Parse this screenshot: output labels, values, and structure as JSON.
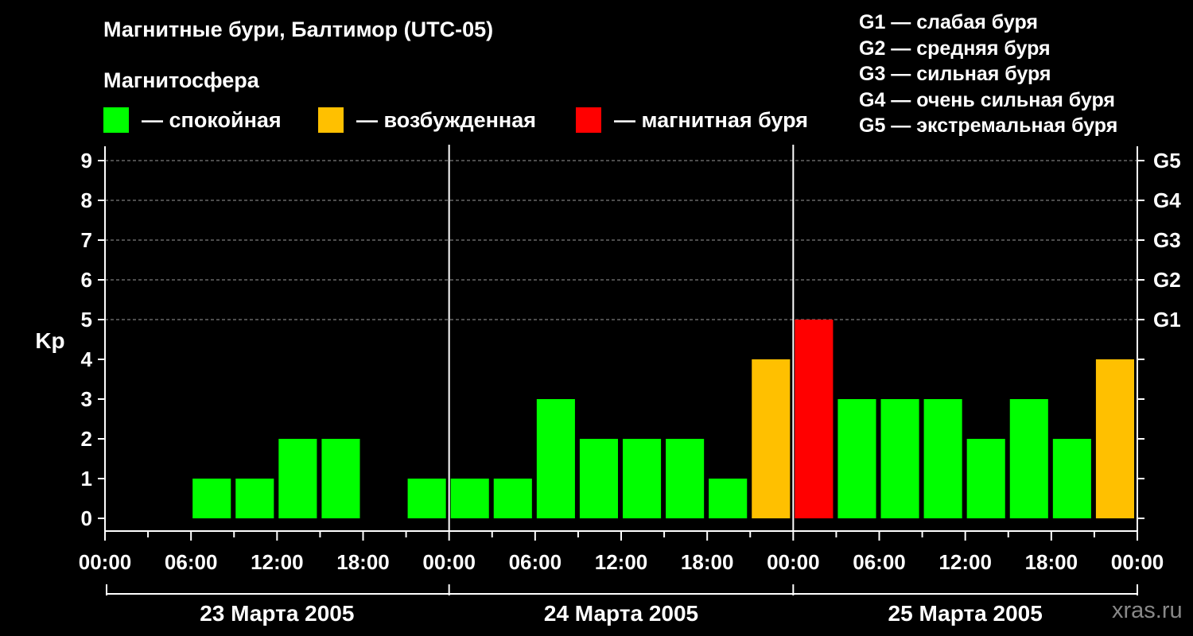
{
  "header": {
    "title": "Магнитные бури, Балтимор (UTC-05)",
    "subtitle": "Магнитосфера"
  },
  "legend": [
    {
      "label": "— спокойная",
      "color": "#00ff00"
    },
    {
      "label": "— возбужденная",
      "color": "#ffc000"
    },
    {
      "label": "— магнитная буря",
      "color": "#ff0000"
    }
  ],
  "g_legend": [
    "G1 — слабая буря",
    "G2 — средняя буря",
    "G3 — сильная буря",
    "G4 — очень сильная буря",
    "G5 — экстремальная буря"
  ],
  "watermark": "xras.ru",
  "chart_data": {
    "type": "bar",
    "ylabel": "Kp",
    "ylim": [
      0,
      9
    ],
    "y_ticks": [
      "0",
      "1",
      "2",
      "3",
      "4",
      "5",
      "6",
      "7",
      "8",
      "9"
    ],
    "right_ticks": [
      {
        "value": 5,
        "label": "G1"
      },
      {
        "value": 6,
        "label": "G2"
      },
      {
        "value": 7,
        "label": "G3"
      },
      {
        "value": 8,
        "label": "G4"
      },
      {
        "value": 9,
        "label": "G5"
      }
    ],
    "grid": "dashed horizontal at 5–9",
    "x_ticks": [
      "00:00",
      "06:00",
      "12:00",
      "18:00",
      "00:00",
      "06:00",
      "12:00",
      "18:00",
      "00:00",
      "06:00",
      "12:00",
      "18:00",
      "00:00"
    ],
    "days": [
      "23 Марта 2005",
      "24 Марта 2005",
      "25 Марта 2005"
    ],
    "interval_hours": 3,
    "values": [
      0,
      0,
      1,
      1,
      2,
      2,
      0,
      1,
      1,
      1,
      3,
      2,
      2,
      2,
      1,
      4,
      5,
      3,
      3,
      3,
      2,
      3,
      2,
      4
    ],
    "levels": [
      "quiet",
      "quiet",
      "quiet",
      "quiet",
      "quiet",
      "quiet",
      "quiet",
      "quiet",
      "quiet",
      "quiet",
      "quiet",
      "quiet",
      "quiet",
      "quiet",
      "quiet",
      "active",
      "storm",
      "quiet",
      "quiet",
      "quiet",
      "quiet",
      "quiet",
      "quiet",
      "active"
    ],
    "colors": {
      "quiet": "#00ff00",
      "active": "#ffc000",
      "storm": "#ff0000"
    }
  }
}
